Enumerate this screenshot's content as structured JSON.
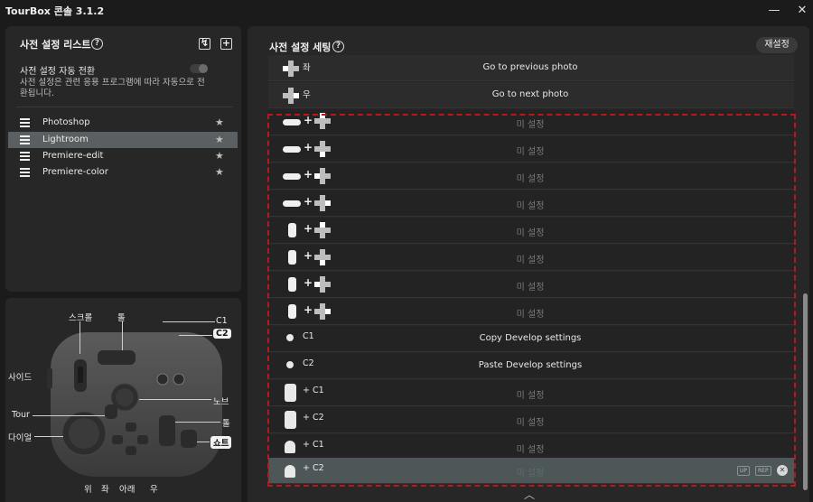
{
  "window": {
    "title": "TourBox 콘솔 3.1.2",
    "minimize": "—",
    "close": "✕"
  },
  "preset_list": {
    "title": "사전 설정 리스트",
    "help": "?",
    "import_icon": "↯",
    "add_icon": "+",
    "auto_switch_label": "사전 설정 자동 전환",
    "auto_switch_on": false,
    "auto_switch_desc": "사전 설정은 관련 응용 프로그램에 따라 자동으로 전환됩니다.",
    "items": [
      {
        "label": "Photoshop",
        "selected": false
      },
      {
        "label": "Lightroom",
        "selected": true
      },
      {
        "label": "Premiere-edit",
        "selected": false
      },
      {
        "label": "Premiere-color",
        "selected": false
      }
    ],
    "star": "★"
  },
  "device": {
    "labels": {
      "scroll": "스크롤",
      "tall": "톨",
      "c1": "C1",
      "c2": "C2",
      "side": "사이드",
      "knob": "노브",
      "tour": "Tour",
      "tall2": "톨",
      "dial": "다이얼",
      "short": "쇼트",
      "up": "위",
      "left": "좌",
      "down": "아래",
      "right": "우"
    }
  },
  "preset_settings": {
    "title": "사전 설정 세팅",
    "help": "?",
    "reset_label": "재설정",
    "rows": [
      {
        "key": "좌",
        "action": "Go to previous photo"
      },
      {
        "key": "우",
        "action": "Go to next photo"
      },
      {
        "key": "",
        "action": "미 설정"
      },
      {
        "key": "",
        "action": "미 설정"
      },
      {
        "key": "",
        "action": "미 설정"
      },
      {
        "key": "",
        "action": "미 설정"
      },
      {
        "key": "",
        "action": "미 설정"
      },
      {
        "key": "",
        "action": "미 설정"
      },
      {
        "key": "",
        "action": "미 설정"
      },
      {
        "key": "",
        "action": "미 설정"
      },
      {
        "key": "C1",
        "action": "Copy Develop settings"
      },
      {
        "key": "C2",
        "action": "Paste Develop settings"
      },
      {
        "key": "+ C1",
        "action": "미 설정"
      },
      {
        "key": "+ C2",
        "action": "미 설정"
      },
      {
        "key": "+ C1",
        "action": "미 설정"
      },
      {
        "key": "+ C2",
        "action": "미 설정"
      }
    ],
    "selected_row_tags": [
      "UP",
      "REP"
    ],
    "remove_icon": "✕",
    "scroll_up_icon": "︿"
  },
  "colors": {
    "selection": "#5a6061",
    "highlight_border": "#c0141b"
  }
}
